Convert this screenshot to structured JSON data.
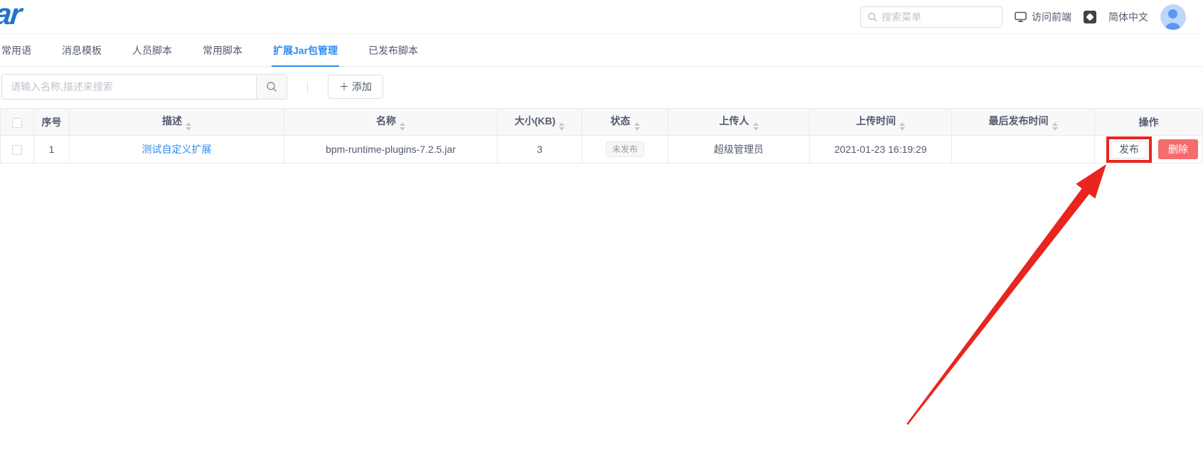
{
  "brand": {
    "logo_text": "ar"
  },
  "topbar": {
    "menu_search_placeholder": "搜索菜单",
    "visit_frontend_label": "访问前端",
    "language_label": "简体中文"
  },
  "tabs": [
    {
      "label": "常用语",
      "active": false
    },
    {
      "label": "消息模板",
      "active": false
    },
    {
      "label": "人员脚本",
      "active": false
    },
    {
      "label": "常用脚本",
      "active": false
    },
    {
      "label": "扩展Jar包管理",
      "active": true
    },
    {
      "label": "已发布脚本",
      "active": false
    }
  ],
  "toolbar": {
    "search_placeholder": "请输入名称,描述来搜索",
    "add_button_label": "＋ 添加"
  },
  "table": {
    "columns": [
      {
        "label": "序号",
        "sortable": false
      },
      {
        "label": "描述",
        "sortable": true
      },
      {
        "label": "名称",
        "sortable": true
      },
      {
        "label": "大小(KB)",
        "sortable": true
      },
      {
        "label": "状态",
        "sortable": true
      },
      {
        "label": "上传人",
        "sortable": true
      },
      {
        "label": "上传时间",
        "sortable": true
      },
      {
        "label": "最后发布时间",
        "sortable": true
      },
      {
        "label": "操作",
        "sortable": false
      }
    ],
    "rows": [
      {
        "index": "1",
        "description": "测试自定义扩展",
        "name": "bpm-runtime-plugins-7.2.5.jar",
        "size_kb": "3",
        "status": "未发布",
        "uploader": "超级管理员",
        "upload_time": "2021-01-23 16:19:29",
        "last_publish_time": "",
        "publish_label": "发布",
        "delete_label": "删除"
      }
    ]
  },
  "colors": {
    "accent_blue": "#2d8cf0",
    "link_blue": "#2d8cf0",
    "danger_red": "#f56c6c",
    "annotation_red": "#e8251f",
    "status_badge_bg": "#f7f7f8",
    "status_badge_text": "#9a9ba1"
  }
}
